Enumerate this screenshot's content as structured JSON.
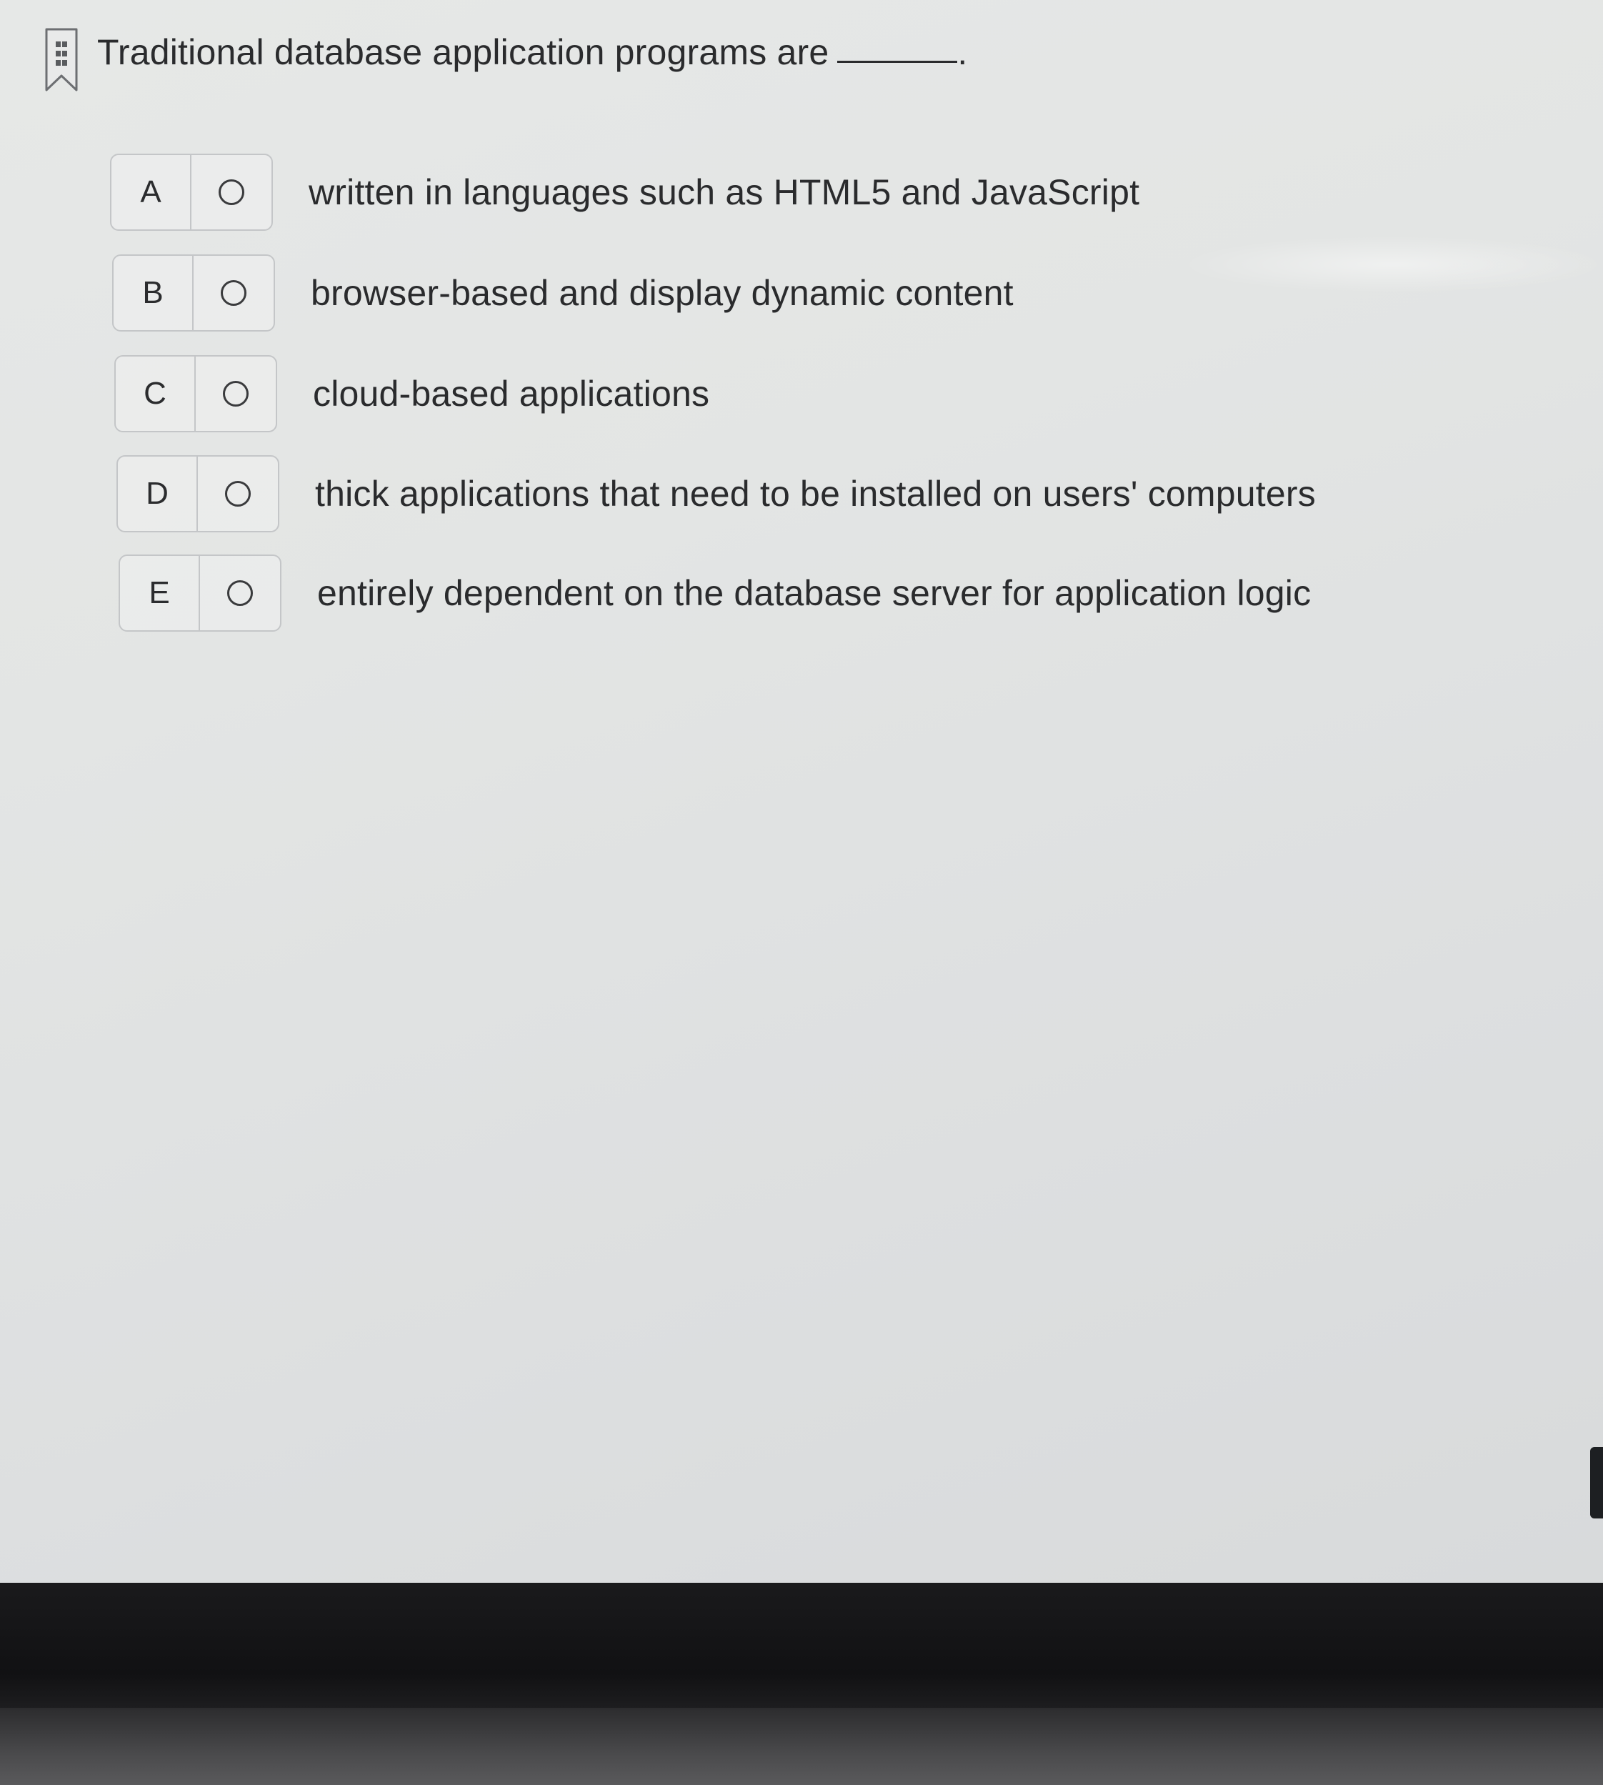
{
  "question": {
    "text": "Traditional database application programs are",
    "end_punct": "."
  },
  "options": [
    {
      "letter": "A",
      "text": "written in languages such as HTML5 and JavaScript"
    },
    {
      "letter": "B",
      "text": "browser-based and display dynamic content"
    },
    {
      "letter": "C",
      "text": "cloud-based applications"
    },
    {
      "letter": "D",
      "text": "thick applications that need to be installed on users' computers"
    },
    {
      "letter": "E",
      "text": "entirely dependent on the database server for application logic"
    }
  ],
  "icons": {
    "bookmark": "bookmark-icon",
    "radio": "radio-button-icon"
  },
  "colors": {
    "background": "#e3e5e4",
    "text": "#2a2b2d",
    "border": "#c4c6c8"
  }
}
